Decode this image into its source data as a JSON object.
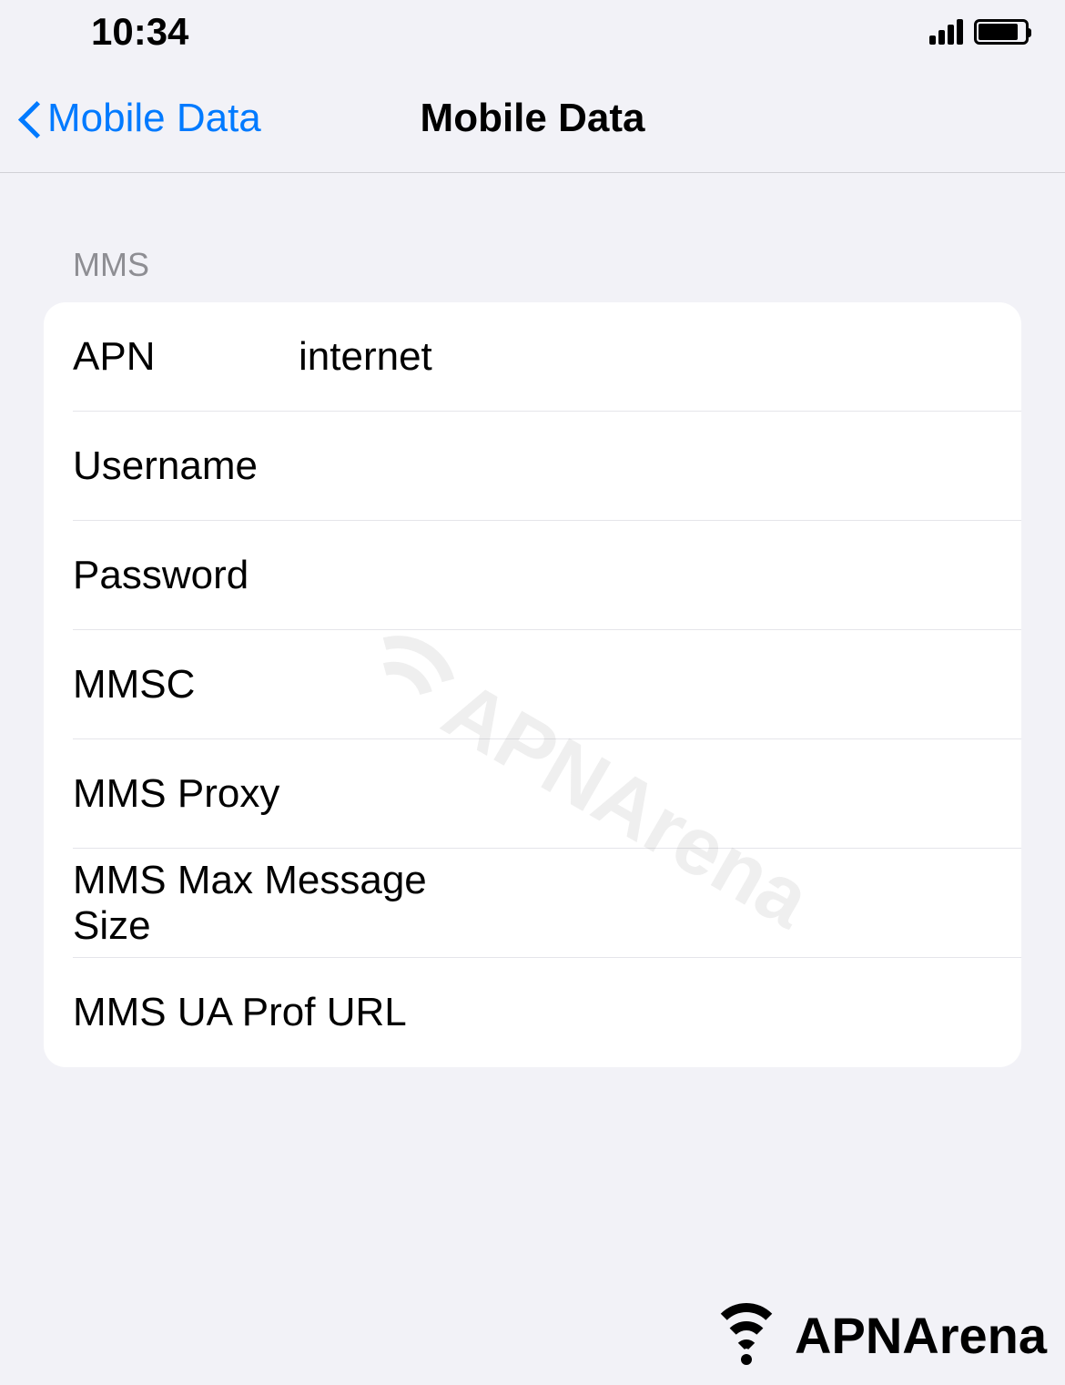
{
  "status_bar": {
    "time": "10:34"
  },
  "nav": {
    "back_label": "Mobile Data",
    "title": "Mobile Data"
  },
  "section": {
    "header": "MMS",
    "rows": [
      {
        "label": "APN",
        "value": "internet"
      },
      {
        "label": "Username",
        "value": ""
      },
      {
        "label": "Password",
        "value": ""
      },
      {
        "label": "MMSC",
        "value": ""
      },
      {
        "label": "MMS Proxy",
        "value": ""
      },
      {
        "label": "MMS Max Message Size",
        "value": ""
      },
      {
        "label": "MMS UA Prof URL",
        "value": ""
      }
    ]
  },
  "watermark": {
    "text": "APNArena"
  },
  "footer": {
    "brand": "APNArena"
  }
}
